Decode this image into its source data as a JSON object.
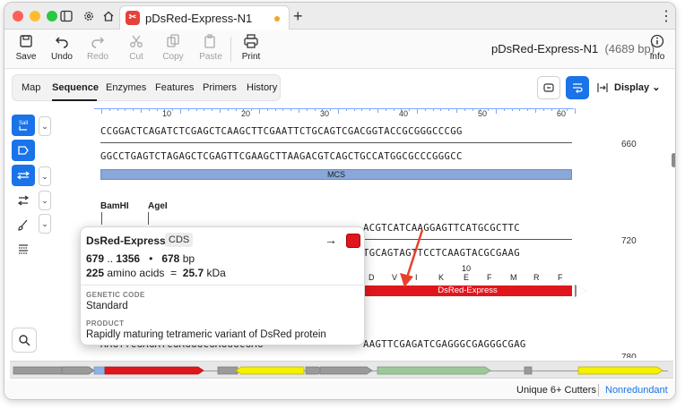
{
  "window": {
    "tab_title": "pDsRed-Express-N1"
  },
  "toolbar": {
    "save": "Save",
    "undo": "Undo",
    "redo": "Redo",
    "cut": "Cut",
    "copy": "Copy",
    "paste": "Paste",
    "print": "Print",
    "info": "Info",
    "sequence_name": "pDsRed-Express-N1",
    "sequence_length": "(4689 bp)"
  },
  "view_tabs": [
    "Map",
    "Sequence",
    "Enzymes",
    "Features",
    "Primers",
    "History"
  ],
  "display_label": "Display",
  "ruler": {
    "ticks": [
      "10",
      "20",
      "30",
      "40",
      "50",
      "60"
    ]
  },
  "sequence_rows": [
    {
      "top": "CCGGACTCAGATCTCGAGCTCAAGCTTCGAATTCTGCAGTCGACGGTACCGCGGGCCCGG",
      "bottom": "GGCCTGAGTCTAGAGCTCGAGTTCGAAGCTTAAGACGTCAGCTGCCATGGCGCCCGGGCC",
      "bp": "660",
      "feature": "MCS"
    },
    {
      "enzymes": [
        "BamHI",
        "AgeI"
      ],
      "top_tail": "ACGTCATCAAGGAGTTCATGCGCTTC",
      "bottom_tail": "TGCAGTAGTTCCTCAAGTACGCGAAG",
      "bp": "720",
      "aa": [
        "D",
        "V",
        "I",
        "K",
        "E",
        "F",
        "M",
        "R",
        "F"
      ],
      "aa_number": "10",
      "feature": "DsRed-Express"
    },
    {
      "top_tail": "AAGTTCGAGATCGAGGGCGAGGGCGAG",
      "bp": "780"
    }
  ],
  "popover": {
    "name": "DsRed-Express",
    "type": "CDS",
    "range_start": "679",
    "range_sep": "..",
    "range_end": "1356",
    "bullet": "•",
    "length": "678",
    "length_unit": "bp",
    "aa_count": "225",
    "aa_label": "amino acids",
    "equals": "=",
    "mass": "25.7",
    "mass_unit": "kDa",
    "genetic_code_label": "GENETIC CODE",
    "genetic_code": "Standard",
    "product_label": "PRODUCT",
    "product": "Rapidly maturing tetrameric variant of DsRed protein"
  },
  "status": {
    "cutters": "Unique 6+ Cutters",
    "mode": "Nonredundant"
  },
  "colors": {
    "accent": "#1a73e8",
    "dsred": "#e0161d",
    "mcs": "#89a7d8"
  }
}
